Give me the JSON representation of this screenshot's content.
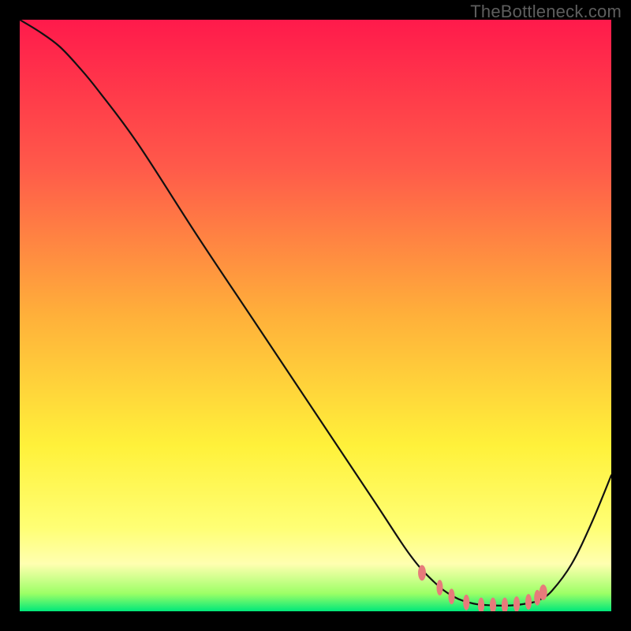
{
  "watermark": "TheBottleneck.com",
  "chart_data": {
    "type": "line",
    "title": "",
    "xlabel": "",
    "ylabel": "",
    "xlim": [
      0,
      100
    ],
    "ylim": [
      0,
      100
    ],
    "series": [
      {
        "name": "curve",
        "x": [
          0.0,
          3.3,
          6.7,
          10.0,
          13.3,
          20.0,
          30.0,
          40.0,
          50.0,
          60.0,
          66.0,
          70.0,
          73.3,
          76.7,
          80.0,
          83.3,
          86.7,
          88.0,
          90.0,
          93.3,
          96.7,
          100.0
        ],
        "y": [
          100.0,
          98.0,
          95.5,
          92.0,
          88.0,
          79.0,
          63.5,
          48.5,
          33.5,
          18.5,
          9.5,
          5.0,
          2.5,
          1.3,
          1.0,
          1.0,
          1.5,
          2.0,
          3.5,
          8.0,
          15.0,
          23.0
        ]
      }
    ],
    "markers": {
      "name": "dots",
      "x": [
        68.0,
        71.0,
        73.0,
        75.5,
        78.0,
        80.0,
        82.0,
        84.0,
        86.0,
        87.5,
        88.5
      ],
      "y": [
        6.5,
        4.0,
        2.5,
        1.5,
        1.0,
        1.0,
        1.0,
        1.2,
        1.6,
        2.3,
        3.2
      ],
      "color": "#e77b7b",
      "size": 9
    },
    "gradient_stops": [
      {
        "pos": 0,
        "color": "#ff1a4b"
      },
      {
        "pos": 25,
        "color": "#ff5a4a"
      },
      {
        "pos": 50,
        "color": "#ffb03a"
      },
      {
        "pos": 72,
        "color": "#fff13a"
      },
      {
        "pos": 86,
        "color": "#ffff75"
      },
      {
        "pos": 92,
        "color": "#ffffb0"
      },
      {
        "pos": 97,
        "color": "#9cff66"
      },
      {
        "pos": 100,
        "color": "#00e87a"
      }
    ]
  }
}
